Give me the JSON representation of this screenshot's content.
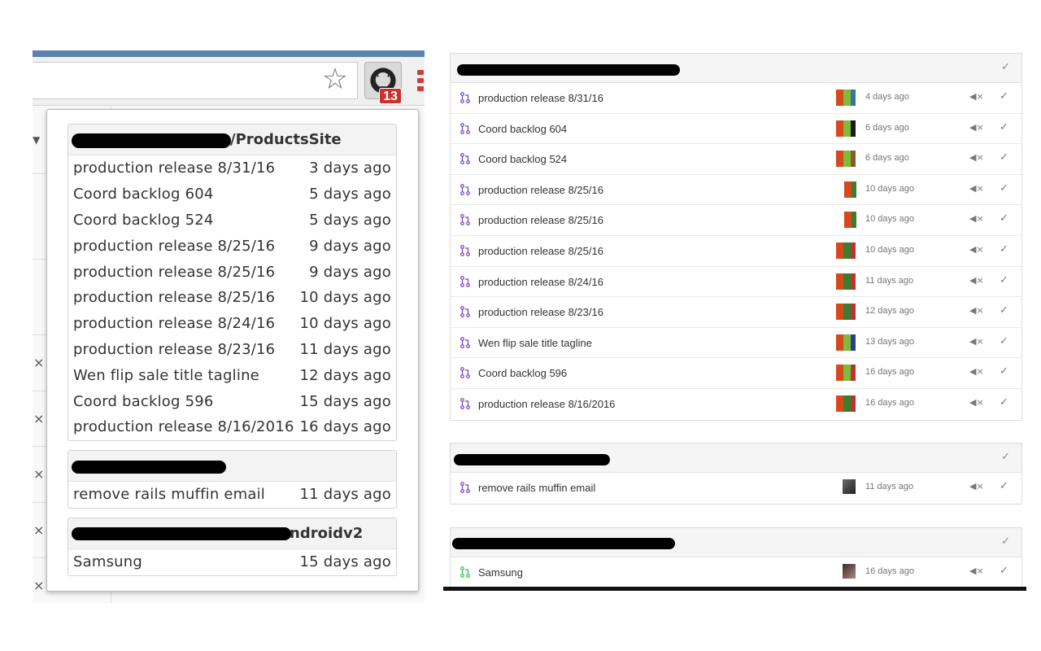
{
  "extension": {
    "badge_count": "13",
    "icons": {
      "star": "bookmark-star-icon",
      "github": "github-octocat-icon",
      "menu": "chrome-menu-icon"
    },
    "colors": {
      "badge": "#c8312f",
      "menu": "#d23b3b"
    }
  },
  "popup": {
    "repos": [
      {
        "name_suffix": "/ProductsSite",
        "items": [
          {
            "title": "production release 8/31/16",
            "ago": "3 days ago"
          },
          {
            "title": "Coord backlog 604",
            "ago": "5 days ago"
          },
          {
            "title": "Coord backlog 524",
            "ago": "5 days ago"
          },
          {
            "title": "production release 8/25/16",
            "ago": "9 days ago"
          },
          {
            "title": "production release 8/25/16",
            "ago": "9 days ago"
          },
          {
            "title": "production release 8/25/16",
            "ago": "10 days ago"
          },
          {
            "title": "production release 8/24/16",
            "ago": "10 days ago"
          },
          {
            "title": "production release 8/23/16",
            "ago": "11 days ago"
          },
          {
            "title": "Wen flip sale title tagline",
            "ago": "12 days ago"
          },
          {
            "title": "Coord backlog 596",
            "ago": "15 days ago"
          },
          {
            "title": "production release 8/16/2016",
            "ago": "16 days ago"
          }
        ]
      },
      {
        "name_suffix": "",
        "items": [
          {
            "title": "remove rails muffin email",
            "ago": "11 days ago"
          }
        ]
      },
      {
        "name_suffix": "ndroidv2",
        "items": [
          {
            "title": "Samsung",
            "ago": "15 days ago"
          }
        ]
      }
    ]
  },
  "notifications": {
    "row_icons": {
      "pull_request": "git-pull-request-icon",
      "mute": "mute-icon",
      "done": "check-icon"
    },
    "mute_label": "◀×",
    "done_label": "✓",
    "groups": [
      {
        "items": [
          {
            "title": "production release 8/31/16",
            "ago": "4 days ago"
          },
          {
            "title": "Coord backlog 604",
            "ago": "6 days ago"
          },
          {
            "title": "Coord backlog 524",
            "ago": "6 days ago"
          },
          {
            "title": "production release 8/25/16",
            "ago": "10 days ago"
          },
          {
            "title": "production release 8/25/16",
            "ago": "10 days ago"
          },
          {
            "title": "production release 8/25/16",
            "ago": "10 days ago"
          },
          {
            "title": "production release 8/24/16",
            "ago": "11 days ago"
          },
          {
            "title": "production release 8/23/16",
            "ago": "12 days ago"
          },
          {
            "title": "Wen flip sale title tagline",
            "ago": "13 days ago"
          },
          {
            "title": "Coord backlog 596",
            "ago": "16 days ago"
          },
          {
            "title": "production release 8/16/2016",
            "ago": "16 days ago"
          }
        ]
      },
      {
        "items": [
          {
            "title": "remove rails muffin email",
            "ago": "11 days ago"
          }
        ]
      },
      {
        "items": [
          {
            "title": "Samsung",
            "ago": "16 days ago"
          }
        ]
      }
    ],
    "colors": {
      "pr_open": "#6f42c1",
      "pr_merged_alt": "#2cbe4e"
    }
  }
}
